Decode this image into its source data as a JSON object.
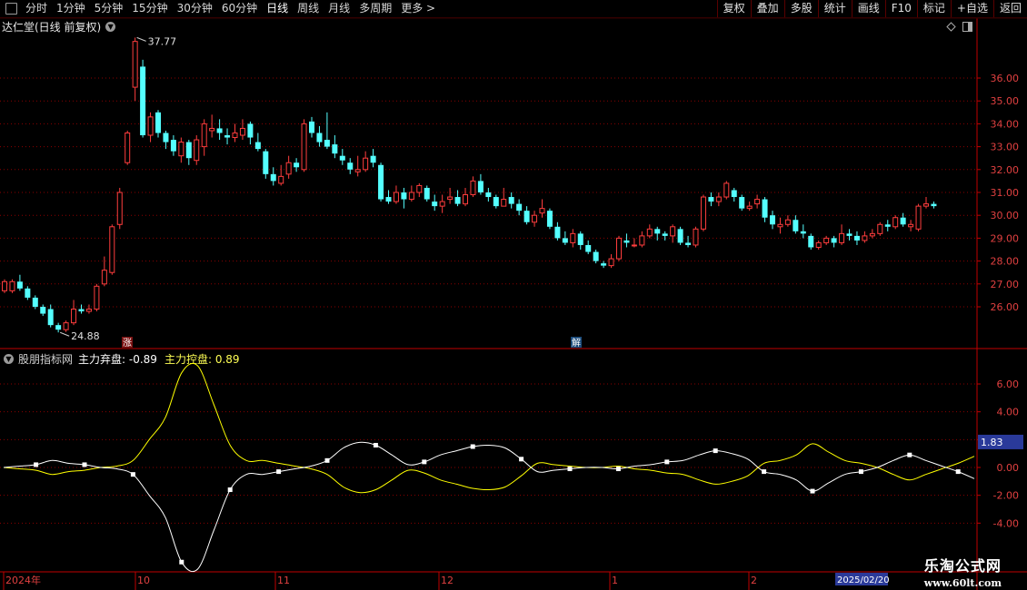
{
  "toolbar": {
    "periods": [
      "分时",
      "1分钟",
      "5分钟",
      "15分钟",
      "30分钟",
      "60分钟",
      "日线",
      "周线",
      "月线",
      "多周期",
      "更多 >"
    ],
    "active_period": "日线",
    "right_buttons": [
      "复权",
      "叠加",
      "多股",
      "统计",
      "画线",
      "F10",
      "标记",
      "+自选",
      "返回"
    ]
  },
  "main_chart": {
    "title": "达仁堂(日线 前复权)",
    "high_label": "37.77",
    "low_label": "24.88",
    "y_ticks": [
      "36.00",
      "35.00",
      "34.00",
      "33.00",
      "32.00",
      "31.00",
      "30.00",
      "29.00",
      "28.00",
      "27.00",
      "26.00"
    ],
    "marker_zhang": "涨",
    "marker_jie": "解"
  },
  "indicator": {
    "name": "股朋指标网",
    "s1_label": "主力弃盘:",
    "s1_value": "-0.89",
    "s2_label": "主力控盘:",
    "s2_value": "0.89",
    "y_ticks": [
      "6.00",
      "4.00",
      "2.00",
      "0.00",
      "-2.00",
      "-4.00"
    ],
    "cursor_value": "1.83"
  },
  "time_axis": {
    "labels": [
      "2024年",
      "10",
      "11",
      "12",
      "1",
      "2"
    ],
    "cursor_date": "2025/02/20"
  },
  "watermark": {
    "text": "乐淘公式网",
    "url": "www.60lt.com"
  },
  "colors": {
    "up": "#ff3d3d",
    "down": "#54ffff",
    "grid": "#8a0000",
    "axis": "#c00000",
    "white_line": "#ffffff",
    "yellow_line": "#ffff00",
    "cursor_box": "#2a3a9a"
  },
  "chart_data": [
    {
      "type": "candlestick",
      "title": "达仁堂(日线 前复权)",
      "ylim": [
        25.2,
        38.0
      ],
      "annotations": {
        "max": 37.77,
        "min": 24.88
      },
      "candles": [
        [
          26.7,
          27.1,
          27.2,
          26.6
        ],
        [
          26.7,
          27.1,
          27.2,
          26.6
        ],
        [
          27.1,
          26.8,
          27.4,
          26.7
        ],
        [
          26.8,
          26.4,
          26.9,
          26.3
        ],
        [
          26.4,
          26.0,
          26.5,
          25.9
        ],
        [
          26.0,
          25.7,
          26.1,
          25.6
        ],
        [
          25.9,
          25.2,
          26.1,
          25.1
        ],
        [
          25.2,
          25.0,
          25.3,
          24.88
        ],
        [
          25.0,
          25.3,
          25.4,
          24.9
        ],
        [
          25.3,
          25.9,
          26.3,
          25.2
        ],
        [
          25.9,
          25.8,
          26.1,
          25.7
        ],
        [
          25.8,
          25.9,
          26.1,
          25.7
        ],
        [
          25.9,
          26.9,
          27.0,
          25.8
        ],
        [
          27.0,
          27.6,
          28.2,
          26.9
        ],
        [
          27.5,
          29.5,
          29.6,
          27.4
        ],
        [
          29.6,
          31.0,
          31.2,
          29.4
        ],
        [
          32.3,
          33.6,
          33.7,
          32.2
        ],
        [
          35.6,
          37.6,
          37.77,
          35.0
        ],
        [
          36.5,
          33.5,
          36.8,
          33.4
        ],
        [
          33.5,
          34.3,
          34.5,
          33.2
        ],
        [
          34.5,
          33.6,
          34.6,
          33.4
        ],
        [
          33.6,
          33.2,
          33.7,
          32.9
        ],
        [
          33.3,
          32.8,
          33.5,
          32.6
        ],
        [
          32.6,
          33.2,
          33.4,
          32.3
        ],
        [
          33.2,
          32.5,
          33.3,
          32.2
        ],
        [
          32.4,
          33.3,
          33.5,
          32.2
        ],
        [
          33.0,
          34.0,
          34.2,
          32.6
        ],
        [
          33.7,
          33.8,
          34.4,
          33.4
        ],
        [
          33.8,
          33.6,
          34.2,
          33.3
        ],
        [
          33.5,
          33.4,
          33.8,
          33.1
        ],
        [
          33.4,
          33.6,
          34.0,
          33.2
        ],
        [
          33.5,
          33.8,
          34.2,
          33.3
        ],
        [
          34.0,
          33.4,
          34.1,
          33.1
        ],
        [
          33.2,
          32.9,
          33.6,
          32.8
        ],
        [
          32.8,
          31.8,
          32.9,
          31.6
        ],
        [
          31.8,
          31.5,
          32.1,
          31.3
        ],
        [
          31.4,
          31.7,
          32.2,
          31.3
        ],
        [
          31.8,
          32.3,
          32.6,
          31.6
        ],
        [
          32.3,
          32.1,
          32.5,
          31.9
        ],
        [
          32.0,
          34.0,
          34.2,
          31.9
        ],
        [
          34.1,
          33.6,
          34.3,
          33.4
        ],
        [
          33.6,
          33.2,
          33.9,
          33.0
        ],
        [
          33.3,
          33.0,
          34.5,
          32.9
        ],
        [
          33.1,
          32.7,
          33.5,
          32.5
        ],
        [
          32.6,
          32.4,
          32.9,
          32.2
        ],
        [
          32.3,
          32.0,
          32.5,
          31.8
        ],
        [
          31.9,
          32.0,
          32.6,
          31.7
        ],
        [
          32.0,
          32.5,
          32.8,
          31.9
        ],
        [
          32.6,
          32.3,
          32.9,
          32.1
        ],
        [
          32.2,
          30.7,
          32.3,
          30.6
        ],
        [
          30.8,
          30.6,
          31.1,
          30.5
        ],
        [
          30.6,
          31.0,
          31.3,
          30.5
        ],
        [
          31.0,
          30.7,
          31.2,
          30.3
        ],
        [
          30.7,
          31.0,
          31.3,
          30.6
        ],
        [
          31.0,
          31.3,
          31.4,
          30.8
        ],
        [
          31.2,
          30.7,
          31.3,
          30.6
        ],
        [
          30.6,
          30.4,
          30.9,
          30.2
        ],
        [
          30.4,
          30.6,
          30.9,
          30.1
        ],
        [
          30.7,
          30.8,
          31.2,
          30.5
        ],
        [
          30.8,
          30.5,
          31.1,
          30.4
        ],
        [
          30.5,
          30.9,
          31.2,
          30.4
        ],
        [
          30.9,
          31.5,
          31.7,
          30.8
        ],
        [
          31.5,
          31.0,
          31.8,
          30.9
        ],
        [
          31.0,
          30.8,
          31.2,
          30.6
        ],
        [
          30.8,
          30.4,
          30.9,
          30.3
        ],
        [
          30.4,
          30.7,
          31.2,
          30.4
        ],
        [
          30.8,
          30.5,
          31.0,
          30.3
        ],
        [
          30.5,
          30.2,
          30.7,
          30.0
        ],
        [
          30.2,
          29.7,
          30.4,
          29.6
        ],
        [
          29.7,
          30.0,
          30.2,
          29.5
        ],
        [
          30.1,
          30.3,
          30.7,
          29.9
        ],
        [
          30.2,
          29.5,
          30.3,
          29.4
        ],
        [
          29.5,
          29.0,
          29.7,
          28.9
        ],
        [
          29.0,
          28.8,
          29.3,
          28.7
        ],
        [
          28.8,
          29.2,
          29.4,
          28.6
        ],
        [
          29.2,
          28.7,
          29.3,
          28.5
        ],
        [
          28.7,
          28.4,
          28.9,
          28.3
        ],
        [
          28.4,
          28.0,
          28.5,
          27.9
        ],
        [
          27.9,
          27.8,
          28.0,
          27.7
        ],
        [
          27.8,
          28.1,
          28.3,
          27.7
        ],
        [
          28.1,
          29.0,
          29.1,
          28.0
        ],
        [
          28.9,
          28.8,
          29.2,
          28.6
        ],
        [
          28.7,
          28.7,
          29.0,
          28.6
        ],
        [
          28.7,
          29.1,
          29.3,
          28.6
        ],
        [
          29.1,
          29.4,
          29.6,
          29.0
        ],
        [
          29.4,
          29.2,
          29.5,
          28.9
        ],
        [
          29.2,
          29.1,
          29.3,
          28.9
        ],
        [
          29.1,
          29.5,
          29.6,
          28.8
        ],
        [
          29.4,
          28.8,
          29.5,
          28.7
        ],
        [
          28.8,
          28.7,
          29.1,
          28.6
        ],
        [
          28.7,
          29.4,
          29.5,
          28.6
        ],
        [
          29.4,
          30.8,
          30.9,
          29.3
        ],
        [
          30.8,
          30.6,
          31.0,
          30.4
        ],
        [
          30.6,
          30.8,
          31.0,
          30.4
        ],
        [
          30.8,
          31.4,
          31.5,
          30.7
        ],
        [
          31.1,
          30.8,
          31.2,
          30.6
        ],
        [
          30.8,
          30.3,
          30.9,
          30.2
        ],
        [
          30.3,
          30.4,
          30.6,
          30.2
        ],
        [
          30.5,
          30.7,
          30.9,
          30.3
        ],
        [
          30.7,
          29.9,
          30.8,
          29.7
        ],
        [
          30.0,
          29.6,
          30.2,
          29.4
        ],
        [
          29.5,
          29.6,
          29.9,
          29.2
        ],
        [
          29.6,
          29.8,
          30.0,
          29.5
        ],
        [
          29.8,
          29.3,
          30.0,
          29.2
        ],
        [
          29.3,
          29.2,
          29.6,
          29.0
        ],
        [
          29.1,
          28.6,
          29.2,
          28.5
        ],
        [
          28.6,
          28.8,
          28.9,
          28.5
        ],
        [
          28.8,
          29.0,
          29.1,
          28.7
        ],
        [
          29.0,
          28.8,
          29.1,
          28.6
        ],
        [
          28.8,
          29.2,
          29.6,
          28.7
        ],
        [
          29.2,
          29.1,
          29.4,
          28.9
        ],
        [
          29.1,
          28.9,
          29.3,
          28.7
        ],
        [
          28.9,
          29.1,
          29.3,
          28.8
        ],
        [
          29.1,
          29.2,
          29.4,
          29.0
        ],
        [
          29.2,
          29.6,
          29.7,
          29.1
        ],
        [
          29.6,
          29.5,
          29.8,
          29.3
        ],
        [
          29.5,
          29.9,
          30.0,
          29.4
        ],
        [
          29.9,
          29.6,
          30.1,
          29.5
        ],
        [
          29.5,
          29.6,
          29.8,
          29.3
        ],
        [
          29.4,
          30.4,
          30.5,
          29.3
        ],
        [
          30.4,
          30.5,
          30.8,
          30.3
        ],
        [
          30.5,
          30.4,
          30.6,
          30.3
        ]
      ]
    },
    {
      "type": "line",
      "title": "股朋指标网",
      "ylim": [
        -5.0,
        7.6
      ],
      "series": [
        {
          "name": "主力弃盘",
          "values": [
            0.0,
            0.1,
            0.2,
            0.5,
            0.3,
            0.2,
            0.0,
            -0.1,
            -0.5,
            -2.0,
            -3.6,
            -6.8,
            -7.3,
            -4.5,
            -1.6,
            -0.5,
            -0.5,
            -0.3,
            -0.1,
            0.1,
            0.5,
            1.4,
            1.8,
            1.6,
            0.9,
            0.2,
            0.4,
            0.9,
            1.2,
            1.5,
            1.6,
            1.4,
            0.6,
            -0.3,
            -0.2,
            -0.1,
            0.0,
            0.0,
            -0.1,
            0.1,
            0.2,
            0.4,
            0.5,
            0.9,
            1.2,
            1.0,
            0.6,
            -0.3,
            -0.5,
            -0.9,
            -1.7,
            -1.1,
            -0.5,
            -0.3,
            0.0,
            0.5,
            0.9,
            0.5,
            0.1,
            -0.3,
            -0.8
          ]
        },
        {
          "name": "主力控盘",
          "values": [
            0.0,
            -0.1,
            -0.2,
            -0.5,
            -0.3,
            -0.2,
            0.0,
            0.1,
            0.5,
            2.0,
            3.6,
            6.8,
            7.3,
            4.5,
            1.6,
            0.5,
            0.5,
            0.3,
            0.1,
            -0.1,
            -0.5,
            -1.4,
            -1.8,
            -1.6,
            -0.9,
            -0.2,
            -0.4,
            -0.9,
            -1.2,
            -1.5,
            -1.6,
            -1.4,
            -0.6,
            0.3,
            0.2,
            0.1,
            0.0,
            0.0,
            0.1,
            -0.1,
            -0.2,
            -0.4,
            -0.5,
            -0.9,
            -1.2,
            -1.0,
            -0.6,
            0.3,
            0.5,
            0.9,
            1.7,
            1.1,
            0.5,
            0.3,
            0.0,
            -0.5,
            -0.9,
            -0.5,
            -0.1,
            0.3,
            0.8
          ]
        }
      ]
    }
  ]
}
